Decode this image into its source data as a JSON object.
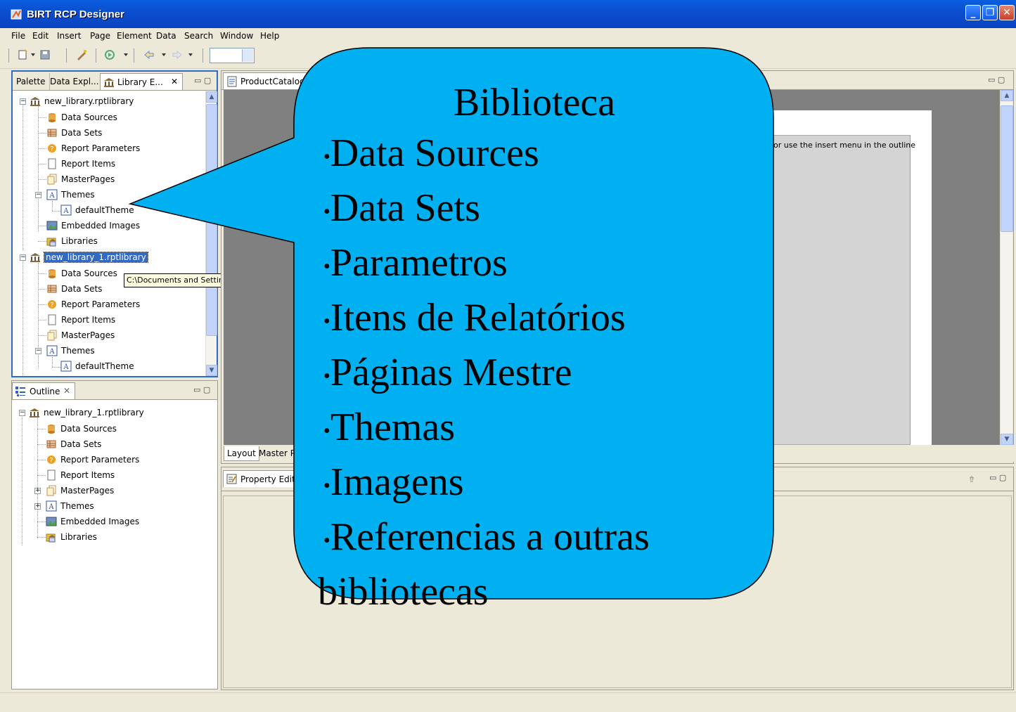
{
  "window": {
    "title": "BIRT RCP Designer"
  },
  "menu": [
    "File",
    "Edit",
    "Insert",
    "Page",
    "Element",
    "Data",
    "Search",
    "Window",
    "Help"
  ],
  "left_tabs": {
    "palette": "Palette",
    "data_explorer": "Data Expl...",
    "library_explorer": "Library E..."
  },
  "library_tree": {
    "lib1": {
      "name": "new_library.rptlibrary",
      "items": [
        "Data Sources",
        "Data Sets",
        "Report Parameters",
        "Report Items",
        "MasterPages",
        "Themes",
        "defaultTheme",
        "Embedded Images",
        "Libraries"
      ]
    },
    "lib2": {
      "name": "new_library_1.rptlibrary",
      "items": [
        "Data Sources",
        "Data Sets",
        "Report Parameters",
        "Report Items",
        "MasterPages",
        "Themes",
        "defaultTheme"
      ]
    }
  },
  "tooltip": "C:\\Documents and Settings\\rodrigo\\My Documents",
  "outline": {
    "tab": "Outline",
    "root": "new_library_1.rptlibrary",
    "items": [
      "Data Sources",
      "Data Sets",
      "Report Parameters",
      "Report Items",
      "MasterPages",
      "Themes",
      "Embedded Images",
      "Libraries"
    ]
  },
  "editor": {
    "tab": "ProductCatalog.rptd",
    "hint": "or use the insert menu in the outline",
    "bottom_tabs": [
      "Layout",
      "Master Pa"
    ]
  },
  "property_editor": {
    "tab": "Property Editor"
  },
  "callout": {
    "title": "Biblioteca",
    "items": [
      "Data Sources",
      "Data Sets",
      "Parametros",
      "Itens de Relatórios",
      "Páginas Mestre",
      "Themas",
      "Imagens",
      "Referencias a outras"
    ],
    "continuation": "bibliotecas",
    "fill": "#00B0F0"
  },
  "colors": {
    "titlebar": "#0A5FE0",
    "chrome": "#ECE9D8",
    "selection": "#316AC5"
  }
}
